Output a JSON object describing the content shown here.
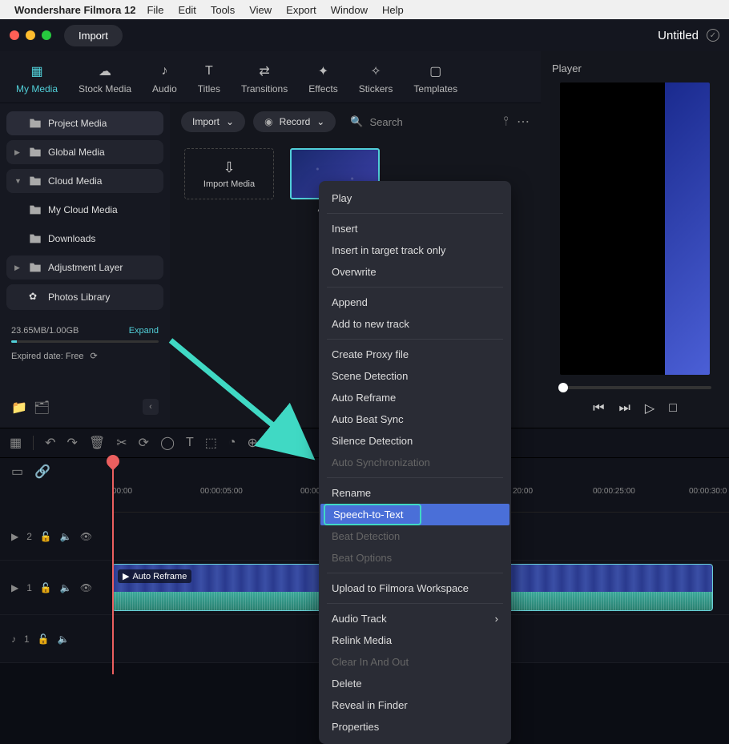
{
  "menubar": {
    "app": "Wondershare Filmora 12",
    "items": [
      "File",
      "Edit",
      "Tools",
      "View",
      "Export",
      "Window",
      "Help"
    ]
  },
  "titlebar": {
    "import": "Import",
    "title": "Untitled"
  },
  "tabs": [
    "My Media",
    "Stock Media",
    "Audio",
    "Titles",
    "Transitions",
    "Effects",
    "Stickers",
    "Templates"
  ],
  "sidebar": {
    "project": "Project Media",
    "global": "Global Media",
    "cloud": "Cloud Media",
    "myCloud": "My Cloud Media",
    "downloads": "Downloads",
    "adjust": "Adjustment Layer",
    "photos": "Photos Library",
    "storageUsed": "23.65MB",
    "storageTotal": "/1.00GB",
    "expand": "Expand",
    "expired": "Expired date: Free"
  },
  "mediaToolbar": {
    "import": "Import",
    "record": "Record",
    "searchPlaceholder": "Search"
  },
  "mediaGrid": {
    "importTile": "Import Media",
    "clip1": "Auto R..."
  },
  "player": {
    "title": "Player"
  },
  "timeline": {
    "labels": [
      "00:00",
      "00:00:05:00",
      "00:00:1",
      "20:00",
      "00:00:25:00",
      "00:00:30:0"
    ],
    "track2": "2",
    "track1v": "1",
    "track1a": "1",
    "clipLabel": "Auto Reframe"
  },
  "contextMenu": {
    "play": "Play",
    "insert": "Insert",
    "insertTarget": "Insert in target track only",
    "overwrite": "Overwrite",
    "append": "Append",
    "addNew": "Add to new track",
    "proxy": "Create Proxy file",
    "scene": "Scene Detection",
    "reframe": "Auto Reframe",
    "beat": "Auto Beat Sync",
    "silence": "Silence Detection",
    "sync": "Auto Synchronization",
    "rename": "Rename",
    "stt": "Speech-to-Text",
    "beatDet": "Beat Detection",
    "beatOpt": "Beat Options",
    "upload": "Upload to Filmora Workspace",
    "audioTrack": "Audio Track",
    "relink": "Relink Media",
    "clearIO": "Clear In And Out",
    "delete": "Delete",
    "reveal": "Reveal in Finder",
    "props": "Properties"
  }
}
